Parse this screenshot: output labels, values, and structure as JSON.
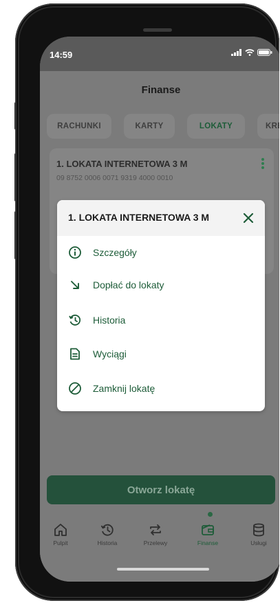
{
  "status_bar": {
    "time": "14:59"
  },
  "header": {
    "title": "Finanse"
  },
  "tabs": [
    {
      "label": "RACHUNKI"
    },
    {
      "label": "KARTY"
    },
    {
      "label": "LOKATY"
    },
    {
      "label": "KRED"
    }
  ],
  "deposit_card": {
    "title": "1. LOKATA INTERNETOWA 3 M",
    "account_number": "09 8752 0006 0071 9319 4000 0010"
  },
  "modal": {
    "title": "1. LOKATA INTERNETOWA 3 M",
    "items": [
      {
        "label": "Szczegóły",
        "icon": "info-icon"
      },
      {
        "label": "Dopłać do lokaty",
        "icon": "arrow-down-right-icon"
      },
      {
        "label": "Historia",
        "icon": "history-icon"
      },
      {
        "label": "Wyciągi",
        "icon": "document-icon"
      },
      {
        "label": "Zamknij lokatę",
        "icon": "block-icon"
      }
    ]
  },
  "primary_button": {
    "label": "Otworz lokatę"
  },
  "bottom_nav": [
    {
      "label": "Pulpit",
      "icon": "home-icon"
    },
    {
      "label": "Historia",
      "icon": "history-icon"
    },
    {
      "label": "Przelewy",
      "icon": "transfer-icon"
    },
    {
      "label": "Finanse",
      "icon": "wallet-icon",
      "active": true
    },
    {
      "label": "Usługi",
      "icon": "database-icon"
    }
  ],
  "colors": {
    "accent": "#1d5c38",
    "overlay": "#7b7b7b",
    "modal_bg": "#ffffff"
  }
}
